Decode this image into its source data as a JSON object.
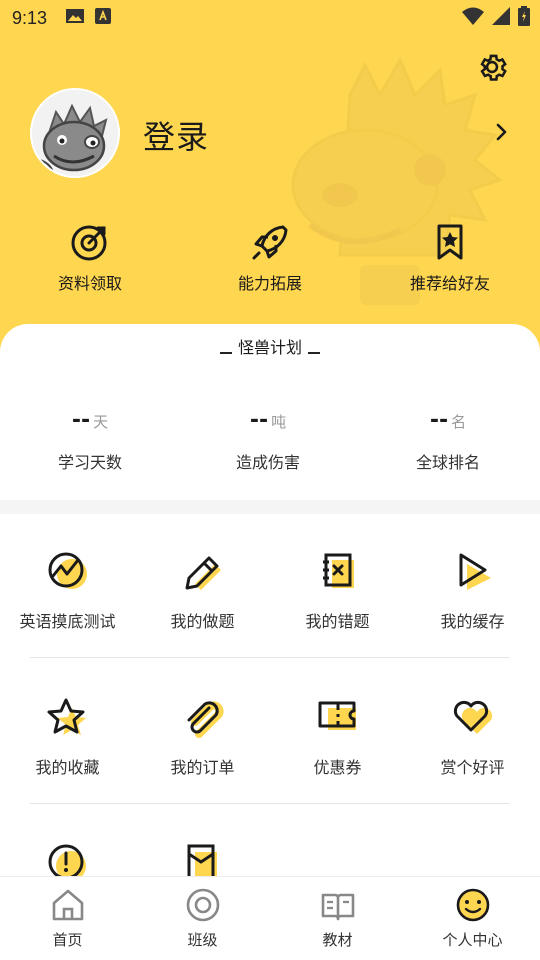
{
  "status_bar": {
    "time": "9:13"
  },
  "profile": {
    "login_label": "登录"
  },
  "quick_actions": [
    {
      "label": "资料领取",
      "icon": "target-icon"
    },
    {
      "label": "能力拓展",
      "icon": "rocket-icon"
    },
    {
      "label": "推荐给好友",
      "icon": "bookmark-star-icon"
    }
  ],
  "plan": {
    "title": "怪兽计划",
    "stats": [
      {
        "value": "--",
        "unit": "天",
        "name": "学习天数"
      },
      {
        "value": "--",
        "unit": "吨",
        "name": "造成伤害"
      },
      {
        "value": "--",
        "unit": "名",
        "name": "全球排名"
      }
    ]
  },
  "menu": [
    {
      "label": "英语摸底测试",
      "icon": "trend-circle-icon"
    },
    {
      "label": "我的做题",
      "icon": "pencil-icon"
    },
    {
      "label": "我的错题",
      "icon": "error-notebook-icon"
    },
    {
      "label": "我的缓存",
      "icon": "play-icon"
    },
    {
      "label": "我的收藏",
      "icon": "star-icon"
    },
    {
      "label": "我的订单",
      "icon": "paperclip-icon"
    },
    {
      "label": "优惠券",
      "icon": "coupon-icon"
    },
    {
      "label": "赏个好评",
      "icon": "heart-icon"
    },
    {
      "label": "",
      "icon": "alert-circle-icon"
    },
    {
      "label": "",
      "icon": "envelope-icon"
    }
  ],
  "tabbar": [
    {
      "label": "首页",
      "icon": "home-icon"
    },
    {
      "label": "班级",
      "icon": "class-disc-icon"
    },
    {
      "label": "教材",
      "icon": "book-icon"
    },
    {
      "label": "个人中心",
      "icon": "smiley-icon"
    }
  ],
  "colors": {
    "accent": "#FFD64F",
    "text": "#1a1a1a",
    "muted": "#999999"
  }
}
